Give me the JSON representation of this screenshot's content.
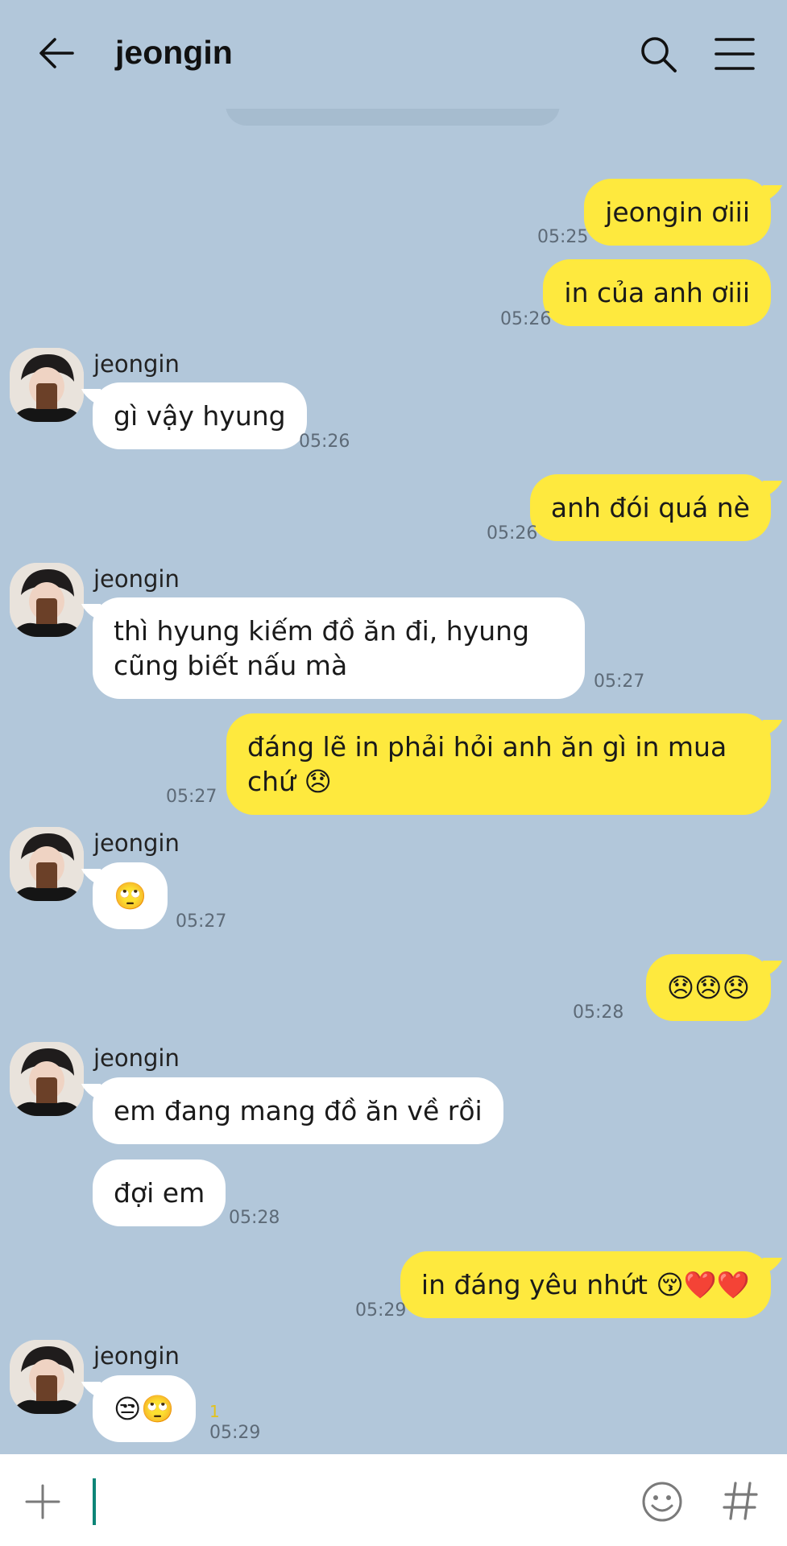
{
  "header": {
    "title": "jeongin"
  },
  "input": {
    "placeholder": ""
  },
  "messages": [
    {
      "dir": "out",
      "text": "jeongin ơiii",
      "time": "05:25"
    },
    {
      "dir": "out",
      "text": "in của anh ơiii",
      "time": "05:26"
    },
    {
      "dir": "in",
      "sender": "jeongin",
      "text": "gì vậy hyung",
      "time": "05:26"
    },
    {
      "dir": "out",
      "text": "anh đói quá nè",
      "time": "05:26"
    },
    {
      "dir": "in",
      "sender": "jeongin",
      "text": "thì hyung kiếm đồ ăn đi, hyung cũng biết nấu mà",
      "time": "05:27"
    },
    {
      "dir": "out",
      "text": "đáng lẽ in phải hỏi anh ăn gì in mua chứ 😞",
      "time": "05:27"
    },
    {
      "dir": "in",
      "sender": "jeongin",
      "text": "🙄",
      "time": "05:27"
    },
    {
      "dir": "out",
      "text": "😞😞😞",
      "time": "05:28"
    },
    {
      "dir": "in",
      "sender": "jeongin",
      "text": "em đang mang đồ ăn về rồi"
    },
    {
      "dir": "in",
      "text": "đợi em",
      "time": "05:28"
    },
    {
      "dir": "out",
      "text": "in đáng yêu nhứt 😚❤️❤️",
      "time": "05:29"
    },
    {
      "dir": "in",
      "sender": "jeongin",
      "text": "😒🙄",
      "unread": "1",
      "time": "05:29"
    }
  ]
}
